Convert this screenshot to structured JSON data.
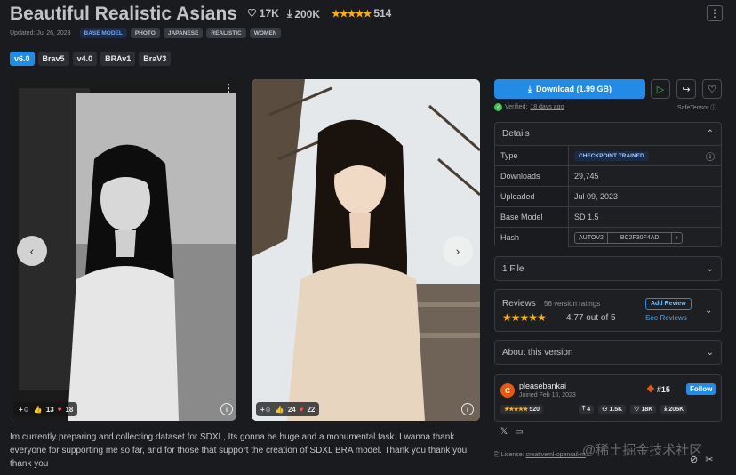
{
  "header": {
    "title": "Beautiful Realistic Asians",
    "likes": "17K",
    "downloads": "200K",
    "stars": "★★★★★",
    "rating_count": "514",
    "updated": "Updated: Jul 26, 2023",
    "tags": [
      "BASE MODEL",
      "PHOTO",
      "JAPANESE",
      "REALISTIC",
      "WOMEN"
    ],
    "menu_glyph": "⋮"
  },
  "versions": [
    "v6.0",
    "Brav5",
    "v4.0",
    "BRAv1",
    "BraV3"
  ],
  "gallery": {
    "prev_glyph": "‹",
    "next_glyph": "›",
    "image1": {
      "likes": "13",
      "hearts": "18"
    },
    "image2": {
      "likes": "24",
      "hearts": "22"
    },
    "more_glyph": "⋮",
    "add_glyph": "+☺",
    "info_glyph": "i"
  },
  "description": "Im currently preparing and collecting dataset for SDXL, Its gonna be huge and a monumental task. I wanna thank everyone for supporting me so far, and for those that support the creation of SDXL BRA model. Thank you thank you thank you",
  "sidebar": {
    "download_label": "Download (1.99 GB)",
    "verified_prefix": "Verified:",
    "verified_date": "18 days ago",
    "safetensor": "SafeTensor",
    "details_title": "Details",
    "details": {
      "type_label": "Type",
      "type_value": "CHECKPOINT TRAINED",
      "downloads_label": "Downloads",
      "downloads_value": "29,745",
      "uploaded_label": "Uploaded",
      "uploaded_value": "Jul 09, 2023",
      "base_label": "Base Model",
      "base_value": "SD 1.5",
      "hash_label": "Hash",
      "hash_algo": "AUTOV2",
      "hash_value": "BC2F30F4AD",
      "hash_arrow": "›"
    },
    "files_title": "1 File",
    "reviews_title": "Reviews",
    "reviews_count": "56 version ratings",
    "reviews_stars": "★★★★★",
    "reviews_score": "4.77 out of 5",
    "add_review": "Add Review",
    "see_reviews": "See Reviews",
    "about_title": "About this version",
    "creator": {
      "initial": "C",
      "name": "pleasebankai",
      "joined": "Joined Feb 16, 2023",
      "rank": "#15",
      "follow": "Follow",
      "stars": "★★★★★",
      "rating": "520",
      "uploads": "4",
      "followers": "1.5K",
      "favorites": "18K",
      "downloads": "205K"
    },
    "license_prefix": "License:",
    "license_value": "creativeml-openrail-m"
  },
  "watermark": "@稀土掘金技术社区",
  "colors": {
    "accent": "#228be6",
    "star": "#fab005",
    "verified": "#40c057",
    "avatar": "#e8590c"
  }
}
